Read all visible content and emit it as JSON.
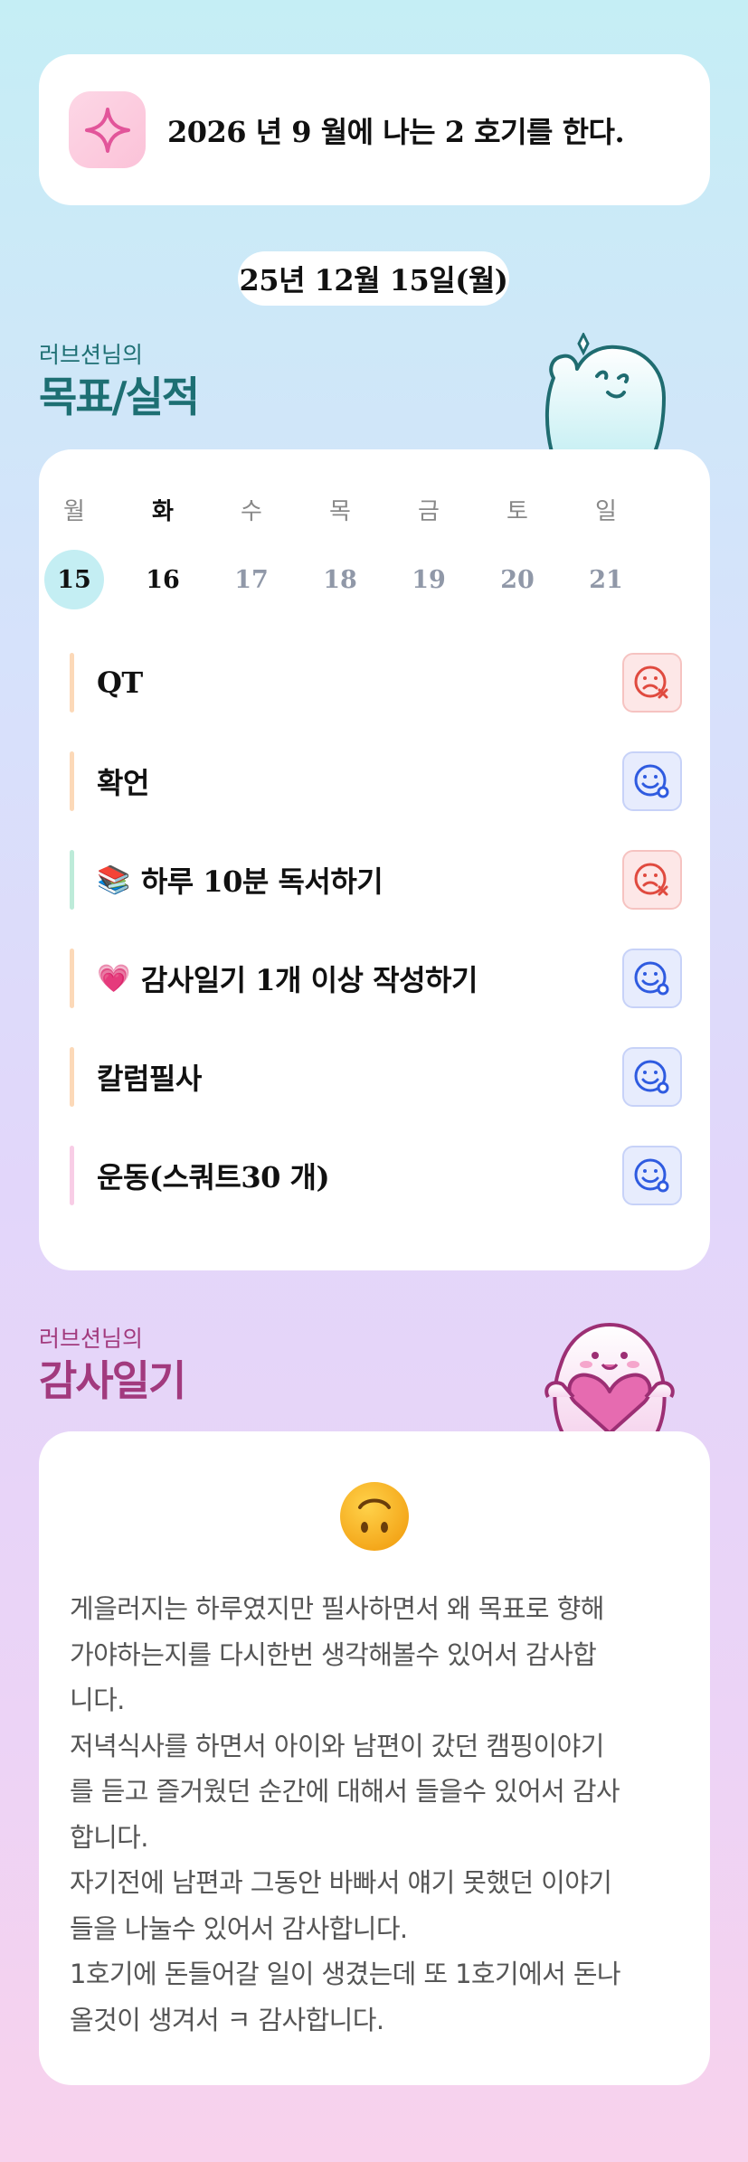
{
  "goal_banner": {
    "icon": "sparkle-icon",
    "text": "2026 년 9 월에 나는 2 호기를 한다."
  },
  "date_pill": "25년 12월 15일(월)",
  "goals_section": {
    "subtitle": "러브션님의",
    "title": "목표/실적",
    "colors": {
      "title": "#1d6f73"
    }
  },
  "week": {
    "days": [
      "월",
      "화",
      "수",
      "목",
      "금",
      "토",
      "일"
    ],
    "dates": [
      "15",
      "16",
      "17",
      "18",
      "19",
      "20",
      "21"
    ],
    "selected_index": 0,
    "today_index": 1
  },
  "tasks": [
    {
      "label": "QT",
      "emoji": "",
      "status": "fail",
      "status_icon": "sad-face-x-icon",
      "bar_color": "#fcd9b8"
    },
    {
      "label": "확언",
      "emoji": "",
      "status": "ok",
      "status_icon": "smile-face-check-icon",
      "bar_color": "#fcd9b8"
    },
    {
      "label": "하루 10분 독서하기",
      "emoji": "📚",
      "status": "fail",
      "status_icon": "sad-face-x-icon",
      "bar_color": "#bdebd9"
    },
    {
      "label": "감사일기 1개 이상 작성하기",
      "emoji": "💗",
      "status": "ok",
      "status_icon": "smile-face-check-icon",
      "bar_color": "#fcd9b8"
    },
    {
      "label": "칼럼필사",
      "emoji": "",
      "status": "ok",
      "status_icon": "smile-face-check-icon",
      "bar_color": "#fcd9b8"
    },
    {
      "label": "운동(스쿼트30 개)",
      "emoji": "",
      "status": "ok",
      "status_icon": "smile-face-check-icon",
      "bar_color": "#f8cde6"
    }
  ],
  "gratitude_section": {
    "subtitle": "러브션님의",
    "title": "감사일기",
    "colors": {
      "title": "#a23a7e"
    }
  },
  "journal": {
    "mood_icon": "upside-down-face-icon",
    "text": "게을러지는 하루였지만 필사하면서 왜 목표로 향해\n가야하는지를 다시한번 생각해볼수 있어서 감사합\n니다.\n저녁식사를 하면서 아이와 남편이 갔던 캠핑이야기\n를 듣고 즐거웠던 순간에 대해서 들을수 있어서 감사\n합니다.\n자기전에 남편과 그동안 바빠서 얘기 못했던 이야기\n들을 나눌수 있어서 감사합니다.\n1호기에 돈들어갈 일이 생겼는데 또 1호기에서 돈나\n올것이 생겨서 ㅋ 감사합니다."
  }
}
